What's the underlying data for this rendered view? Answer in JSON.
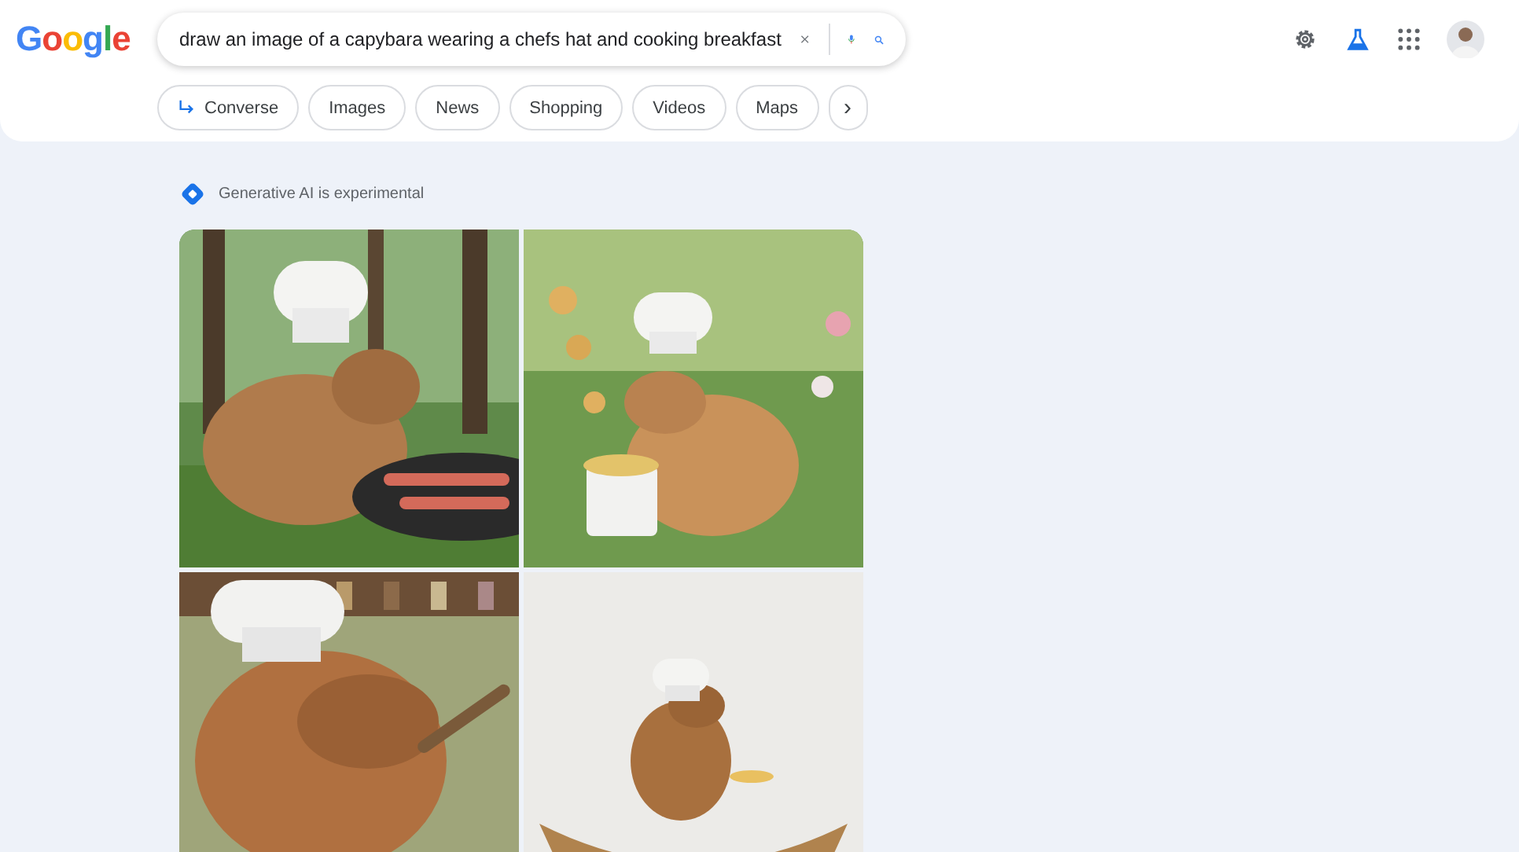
{
  "logo": "Google",
  "search": {
    "value": "draw an image of a capybara wearing a chefs hat and cooking breakfast"
  },
  "chips": [
    {
      "label": "Converse",
      "kind": "converse"
    },
    {
      "label": "Images",
      "kind": "plain"
    },
    {
      "label": "News",
      "kind": "plain"
    },
    {
      "label": "Shopping",
      "kind": "plain"
    },
    {
      "label": "Videos",
      "kind": "plain"
    },
    {
      "label": "Maps",
      "kind": "plain"
    },
    {
      "label": "›",
      "kind": "more"
    }
  ],
  "notice": "Generative AI is experimental"
}
